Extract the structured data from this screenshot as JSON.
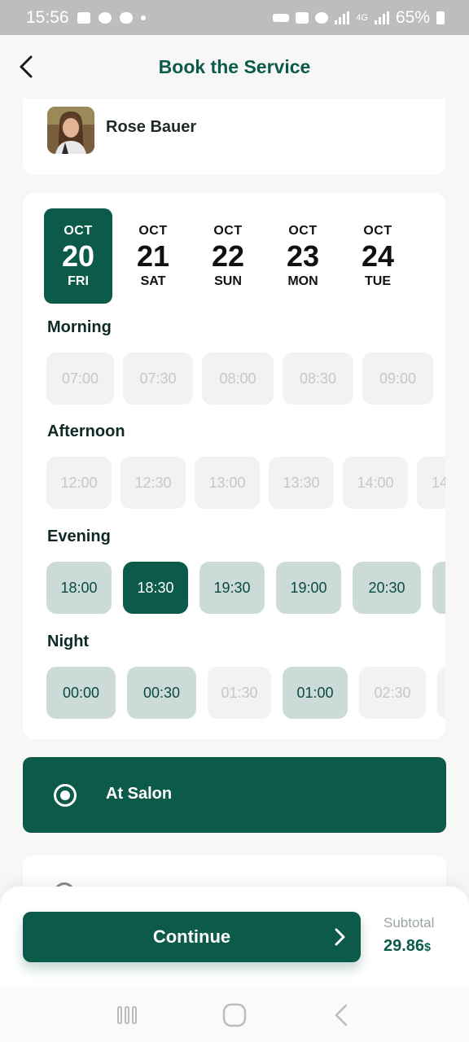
{
  "status_bar": {
    "time": "15:56",
    "battery": "65%",
    "network": "4G"
  },
  "header": {
    "title": "Book the Service",
    "back_icon": "chevron-left-icon"
  },
  "profile": {
    "name": "Rose Bauer"
  },
  "dates": [
    {
      "month": "OCT",
      "day": "20",
      "weekday": "FRI",
      "selected": true
    },
    {
      "month": "OCT",
      "day": "21",
      "weekday": "SAT",
      "selected": false
    },
    {
      "month": "OCT",
      "day": "22",
      "weekday": "SUN",
      "selected": false
    },
    {
      "month": "OCT",
      "day": "23",
      "weekday": "MON",
      "selected": false
    },
    {
      "month": "OCT",
      "day": "24",
      "weekday": "TUE",
      "selected": false
    }
  ],
  "sections": {
    "morning": {
      "title": "Morning",
      "slots": [
        "07:00",
        "07:30",
        "08:00",
        "08:30",
        "09:00"
      ]
    },
    "afternoon": {
      "title": "Afternoon",
      "slots": [
        "12:00",
        "12:30",
        "13:00",
        "13:30",
        "14:00",
        "14"
      ]
    },
    "evening": {
      "title": "Evening",
      "slots": [
        "18:00",
        "18:30",
        "19:30",
        "19:00",
        "20:30"
      ]
    },
    "night": {
      "title": "Night",
      "slots": [
        "00:00",
        "00:30",
        "01:30",
        "01:00",
        "02:30"
      ]
    }
  },
  "options": {
    "salon_label": "At Salon"
  },
  "footer": {
    "continue_label": "Continue",
    "subtotal_label": "Subtotal",
    "subtotal_value": "29.86",
    "currency": "$"
  },
  "colors": {
    "brand": "#0b5a4a",
    "slot_available": "#ccdbd7",
    "slot_unavailable": "#f2f2f2"
  }
}
